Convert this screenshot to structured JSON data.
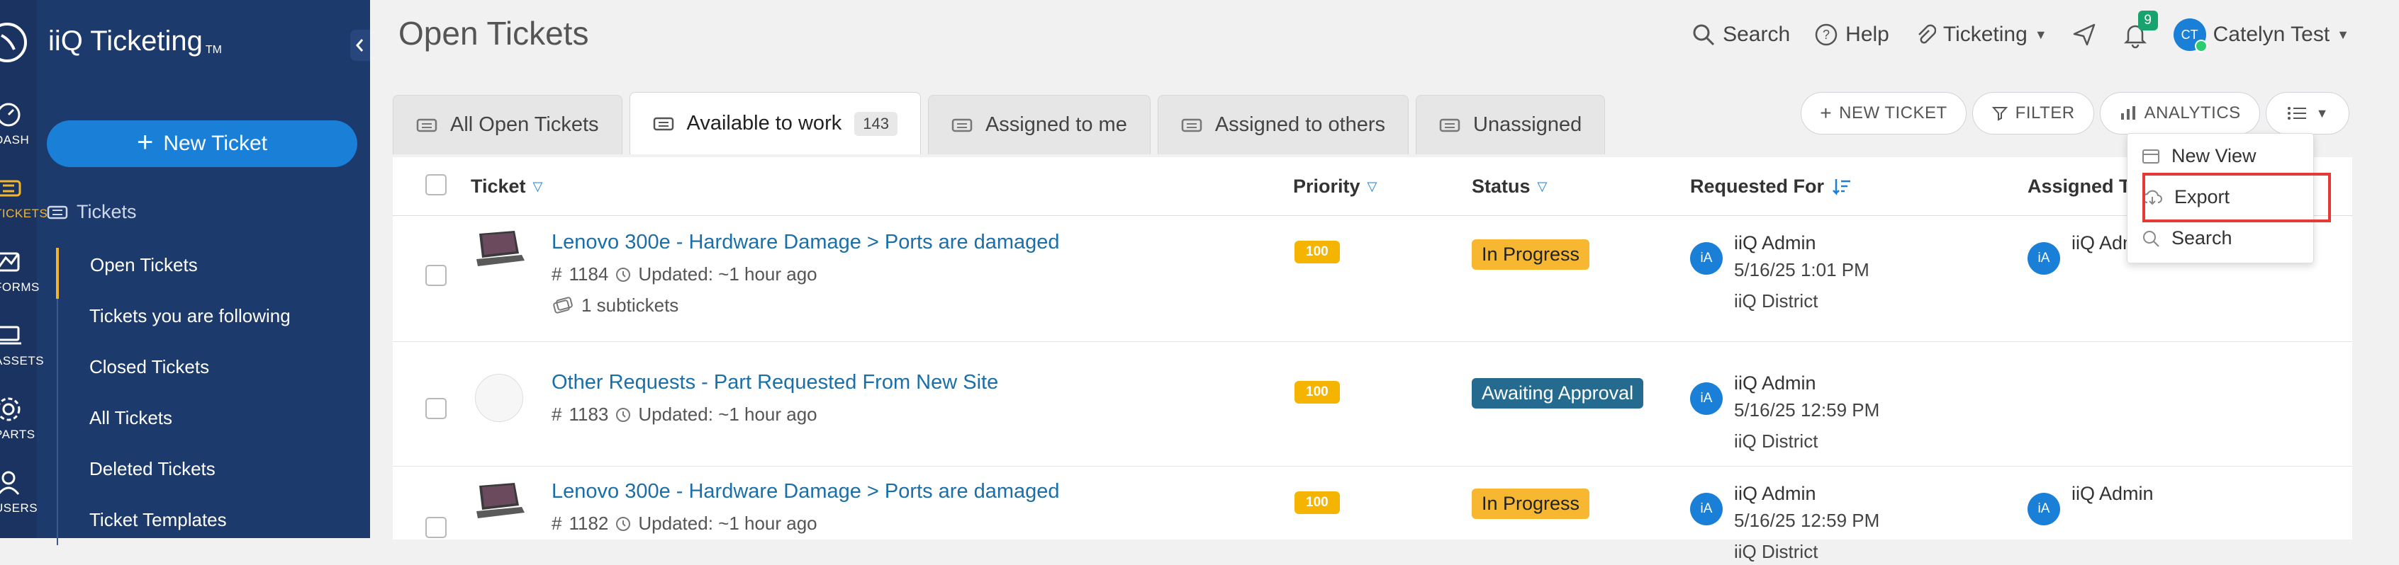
{
  "app": {
    "title": "iiQ Ticketing",
    "trademark": "TM"
  },
  "rail": [
    {
      "label": "DASH",
      "icon": "dashboard-icon"
    },
    {
      "label": "TICKETS",
      "icon": "ticket-icon",
      "active": true
    },
    {
      "label": "FORMS",
      "icon": "forms-icon"
    },
    {
      "label": "ASSETS",
      "icon": "laptop-icon"
    },
    {
      "label": "PARTS",
      "icon": "gear-icon"
    },
    {
      "label": "USERS",
      "icon": "user-icon"
    }
  ],
  "sidebar": {
    "new_ticket_label": "New Ticket",
    "section_title": "Tickets",
    "items": [
      {
        "label": "Open Tickets",
        "active": true
      },
      {
        "label": "Tickets you are following"
      },
      {
        "label": "Closed Tickets"
      },
      {
        "label": "All Tickets"
      },
      {
        "label": "Deleted Tickets"
      },
      {
        "label": "Ticket Templates"
      }
    ]
  },
  "header": {
    "page_title": "Open Tickets",
    "search_label": "Search",
    "help_label": "Help",
    "module_label": "Ticketing",
    "notification_count": "9",
    "user_initials": "CT",
    "user_name": "Catelyn Test"
  },
  "tabs": [
    {
      "label": "All Open Tickets"
    },
    {
      "label": "Available to work",
      "count": "143",
      "active": true
    },
    {
      "label": "Assigned to me"
    },
    {
      "label": "Assigned to others"
    },
    {
      "label": "Unassigned"
    }
  ],
  "toolbar": {
    "new_ticket": "NEW TICKET",
    "filter": "FILTER",
    "analytics": "ANALYTICS"
  },
  "menu": {
    "items": [
      "New View",
      "Export",
      "Search"
    ],
    "highlighted": "Export"
  },
  "table": {
    "columns": {
      "ticket": "Ticket",
      "priority": "Priority",
      "status": "Status",
      "requested_for": "Requested For",
      "assigned_to": "Assigned To"
    },
    "rows": [
      {
        "title": "Lenovo 300e - Hardware Damage > Ports are damaged",
        "number": "1184",
        "updated": "Updated: ~1 hour ago",
        "subtickets": "1 subtickets",
        "priority": "100",
        "status": "In Progress",
        "requester_initials": "iA",
        "requester_name": "iiQ Admin",
        "requested_date": "5/16/25 1:01 PM",
        "location": "iiQ District",
        "assignee_initials": "iA",
        "assignee_name": "iiQ Adm"
      },
      {
        "title": "Other Requests - Part Requested From New Site",
        "number": "1183",
        "updated": "Updated: ~1 hour ago",
        "priority": "100",
        "status": "Awaiting Approval",
        "requester_initials": "iA",
        "requester_name": "iiQ Admin",
        "requested_date": "5/16/25 12:59 PM",
        "location": "iiQ District"
      },
      {
        "title": "Lenovo 300e - Hardware Damage > Ports are damaged",
        "number": "1182",
        "updated": "Updated: ~1 hour ago",
        "priority": "100",
        "status": "In Progress",
        "requester_initials": "iA",
        "requester_name": "iiQ Admin",
        "requested_date": "5/16/25 12:59 PM",
        "location": "iiQ District",
        "assignee_initials": "iA",
        "assignee_name": "iiQ Admin"
      }
    ]
  },
  "colors": {
    "rail_bg": "#1a3360",
    "sidebar_bg": "#1c3a6c",
    "accent_blue": "#1a7fd6",
    "active_yellow": "#f5b52a",
    "priority_bg": "#f4b400",
    "status_in_progress": "#f7b731",
    "status_awaiting": "#256a8f",
    "highlight_red": "#e53935"
  }
}
